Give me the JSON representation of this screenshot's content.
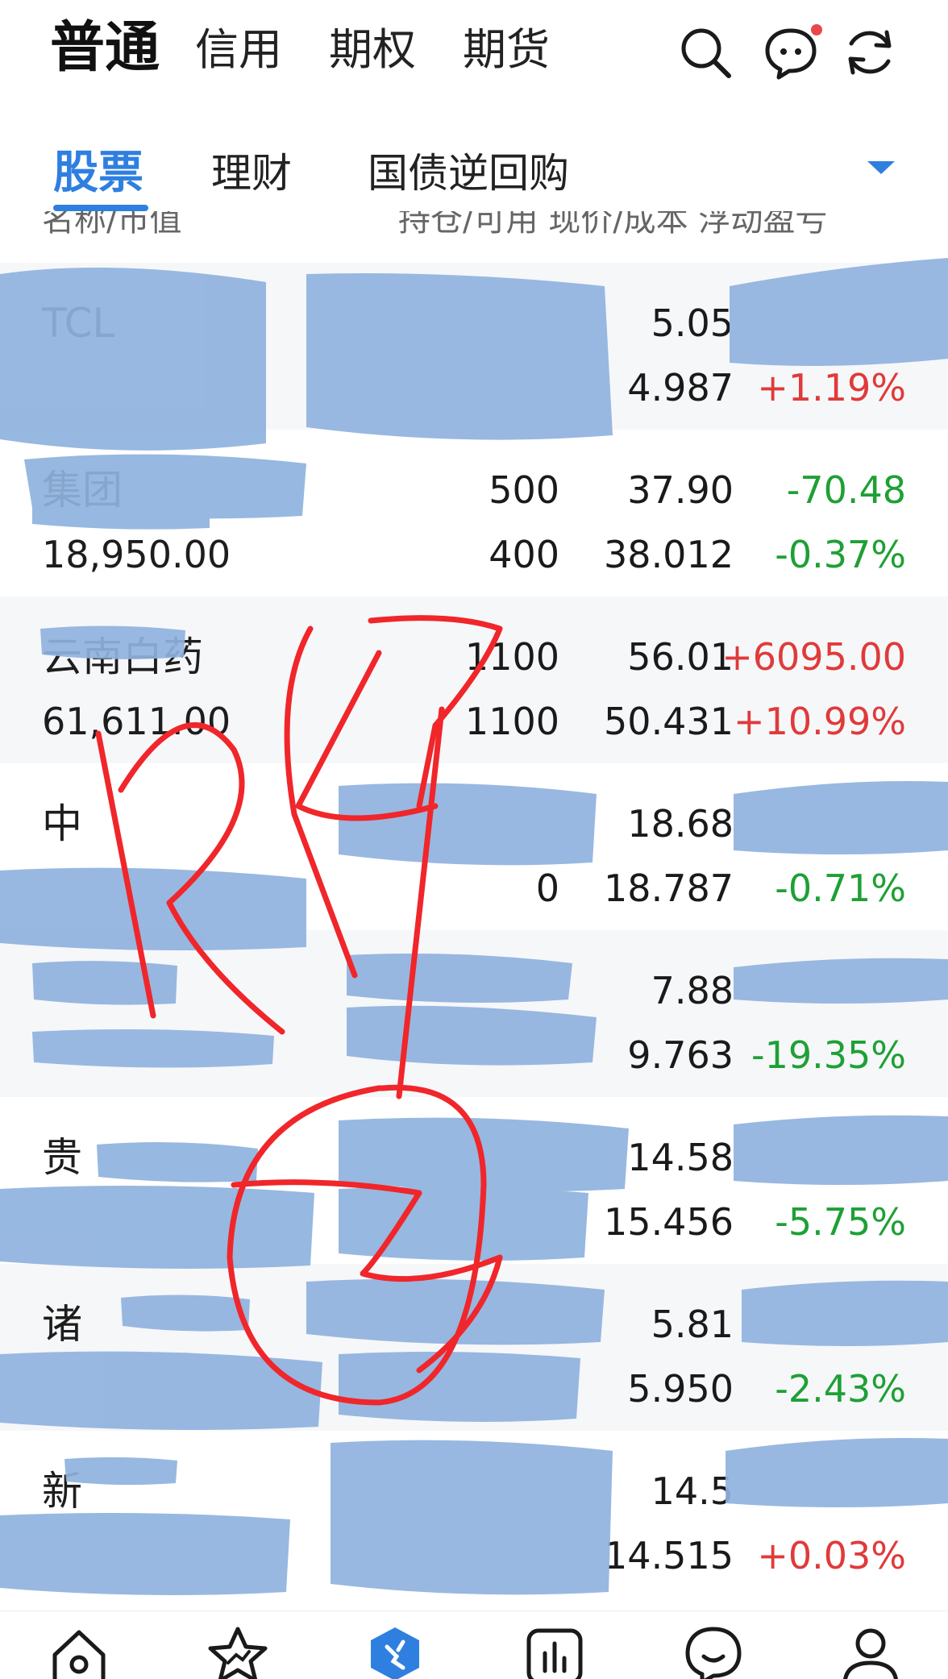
{
  "account_tabs": [
    {
      "label": "普通",
      "active": true
    },
    {
      "label": "信用",
      "active": false
    },
    {
      "label": "期权",
      "active": false
    },
    {
      "label": "期货",
      "active": false
    }
  ],
  "top_icons": [
    "search-icon",
    "message-icon",
    "refresh-icon"
  ],
  "product_tabs": [
    {
      "label": "股票",
      "active": true
    },
    {
      "label": "理财",
      "active": false
    },
    {
      "label": "国债逆回购",
      "active": false
    }
  ],
  "column_header": {
    "left": "名称/市值",
    "right": "持仓/可用 现价/成本 浮动盈亏"
  },
  "holdings": [
    {
      "name": "TCL",
      "market_value": "",
      "qty": "",
      "avail": "",
      "price": "5.05",
      "cost": "4.987",
      "pl": "",
      "pl_pct": "+1.19%",
      "pl_dir": "up",
      "pct_dir": "up"
    },
    {
      "name": "集团",
      "market_value": "18,950.00",
      "qty": "500",
      "avail": "400",
      "price": "37.90",
      "cost": "38.012",
      "pl": "-70.48",
      "pl_pct": "-0.37%",
      "pl_dir": "down",
      "pct_dir": "down"
    },
    {
      "name": "云南白药",
      "market_value": "61,611.00",
      "qty": "1100",
      "avail": "1100",
      "price": "56.01",
      "cost": "50.431",
      "pl": "+6095.00",
      "pl_pct": "+10.99%",
      "pl_dir": "up",
      "pct_dir": "up"
    },
    {
      "name": "中",
      "market_value": "",
      "qty": "",
      "avail": "0",
      "price": "18.68",
      "cost": "18.787",
      "pl": "",
      "pl_pct": "-0.71%",
      "pl_dir": "down",
      "pct_dir": "down"
    },
    {
      "name": "",
      "market_value": "",
      "qty": "",
      "avail": "",
      "price": "7.88",
      "cost": "9.763",
      "pl": "",
      "pl_pct": "-19.35%",
      "pl_dir": "down",
      "pct_dir": "down"
    },
    {
      "name": "贵",
      "market_value": "",
      "qty": "",
      "avail": "",
      "price": "14.58",
      "cost": "15.456",
      "pl": "",
      "pl_pct": "-5.75%",
      "pl_dir": "down",
      "pct_dir": "down"
    },
    {
      "name": "诸",
      "market_value": "",
      "qty": "",
      "avail": "",
      "price": "5.81",
      "cost": "5.950",
      "pl": "",
      "pl_pct": "-2.43%",
      "pl_dir": "down",
      "pct_dir": "down"
    },
    {
      "name": "新",
      "market_value": "",
      "qty": "",
      "avail": "",
      "price": "14.5",
      "cost": "14.515",
      "pl": "",
      "pl_pct": "+0.03%",
      "pl_dir": "up",
      "pct_dir": "up"
    }
  ],
  "bottom_nav": [
    {
      "icon": "home-icon",
      "active": false
    },
    {
      "icon": "star-icon",
      "active": false
    },
    {
      "icon": "trade-icon",
      "active": true
    },
    {
      "icon": "market-chart-icon",
      "active": false
    },
    {
      "icon": "chat-icon",
      "active": false
    },
    {
      "icon": "profile-icon",
      "active": false
    }
  ],
  "colors": {
    "accent": "#2f7fe0",
    "up": "#e03a3a",
    "down": "#1ea035",
    "scribble": "#8fb2de",
    "doodle": "#f0262a"
  }
}
